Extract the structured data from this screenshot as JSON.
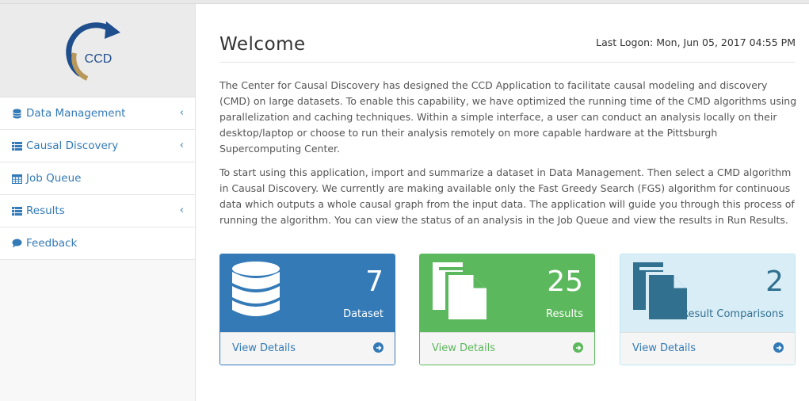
{
  "app": {
    "logo_text": "CCD"
  },
  "sidebar": {
    "items": [
      {
        "label": "Data Management",
        "icon": "database-icon",
        "has_submenu": true
      },
      {
        "label": "Causal Discovery",
        "icon": "list-icon",
        "has_submenu": true
      },
      {
        "label": "Job Queue",
        "icon": "calendar-icon",
        "has_submenu": false
      },
      {
        "label": "Results",
        "icon": "list-icon",
        "has_submenu": true
      },
      {
        "label": "Feedback",
        "icon": "comment-icon",
        "has_submenu": false
      }
    ]
  },
  "header": {
    "title": "Welcome",
    "last_logon": "Last Logon: Mon, Jun 05, 2017 04:55 PM"
  },
  "content": {
    "paragraph1": "The Center for Causal Discovery has designed the CCD Application to facilitate causal modeling and discovery (CMD) on large datasets. To enable this capability, we have optimized the running time of the CMD algorithms using parallelization and caching techniques. Within a simple interface, a user can conduct an analysis locally on their desktop/laptop or choose to run their analysis remotely on more capable hardware at the Pittsburgh Supercomputing Center.",
    "paragraph2": "To start using this application, import and summarize a dataset in Data Management. Then select a CMD algorithm in Causal Discovery. We currently are making available only the Fast Greedy Search (FGS) algorithm for continuous data which outputs a whole causal graph from the input data. The application will guide you through this process of running the algorithm. You can view the status of an analysis in the Job Queue and view the results in Run Results."
  },
  "panels": [
    {
      "count": "7",
      "label": "Dataset",
      "link": "View Details",
      "icon": "database-icon"
    },
    {
      "count": "25",
      "label": "Results",
      "link": "View Details",
      "icon": "files-icon"
    },
    {
      "count": "2",
      "label": "Result Comparisons",
      "link": "View Details",
      "icon": "files-icon"
    }
  ],
  "colors": {
    "primary": "#337ab7",
    "success": "#5cb85c",
    "info_bg": "#d9edf7",
    "logo_gold": "#b8975a"
  }
}
